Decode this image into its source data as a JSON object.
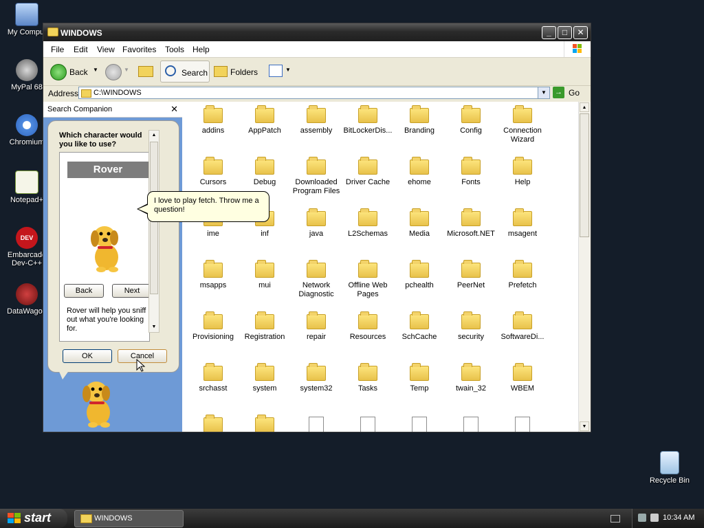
{
  "desktop": {
    "icons": [
      {
        "label": "My Comput",
        "icon": "computer-icon"
      },
      {
        "label": "MyPal 68",
        "icon": "raccoon-icon"
      },
      {
        "label": "Chromium",
        "icon": "chromium-icon"
      },
      {
        "label": "Notepad+",
        "icon": "notepad-icon"
      },
      {
        "label": "Embarcade\nDev-C++",
        "icon": "devcpp-icon"
      },
      {
        "label": "DataWagon",
        "icon": "datawagon-icon"
      }
    ],
    "recycle_bin": "Recycle Bin"
  },
  "window": {
    "title": "WINDOWS",
    "menu": [
      "File",
      "Edit",
      "View",
      "Favorites",
      "Tools",
      "Help"
    ],
    "toolbar": {
      "back": "Back",
      "search": "Search",
      "folders": "Folders"
    },
    "address": {
      "label": "Address",
      "value": "C:\\WINDOWS",
      "go": "Go"
    }
  },
  "companion": {
    "title": "Search Companion",
    "question": "Which character would you like to use?",
    "character_name": "Rover",
    "back": "Back",
    "next": "Next",
    "description": "Rover will help you sniff out what you're looking for.",
    "ok": "OK",
    "cancel": "Cancel",
    "speech": "I love to play fetch. Throw me a question!"
  },
  "files": [
    {
      "name": "addins",
      "type": "folder"
    },
    {
      "name": "AppPatch",
      "type": "folder"
    },
    {
      "name": "assembly",
      "type": "folder"
    },
    {
      "name": "BitLockerDis...",
      "type": "folder"
    },
    {
      "name": "Branding",
      "type": "folder"
    },
    {
      "name": "Config",
      "type": "folder"
    },
    {
      "name": "Connection Wizard",
      "type": "folder"
    },
    {
      "name": "Cursors",
      "type": "folder"
    },
    {
      "name": "Debug",
      "type": "folder"
    },
    {
      "name": "Downloaded Program Files",
      "type": "folder"
    },
    {
      "name": "Driver Cache",
      "type": "folder"
    },
    {
      "name": "ehome",
      "type": "folder"
    },
    {
      "name": "Fonts",
      "type": "folder"
    },
    {
      "name": "Help",
      "type": "folder"
    },
    {
      "name": "ime",
      "type": "folder"
    },
    {
      "name": "inf",
      "type": "folder"
    },
    {
      "name": "java",
      "type": "folder"
    },
    {
      "name": "L2Schemas",
      "type": "folder"
    },
    {
      "name": "Media",
      "type": "folder"
    },
    {
      "name": "Microsoft.NET",
      "type": "folder"
    },
    {
      "name": "msagent",
      "type": "folder"
    },
    {
      "name": "msapps",
      "type": "folder"
    },
    {
      "name": "mui",
      "type": "folder"
    },
    {
      "name": "Network Diagnostic",
      "type": "folder"
    },
    {
      "name": "Offline Web Pages",
      "type": "folder"
    },
    {
      "name": "pchealth",
      "type": "folder"
    },
    {
      "name": "PeerNet",
      "type": "folder"
    },
    {
      "name": "Prefetch",
      "type": "folder"
    },
    {
      "name": "Provisioning",
      "type": "folder"
    },
    {
      "name": "Registration",
      "type": "folder"
    },
    {
      "name": "repair",
      "type": "folder"
    },
    {
      "name": "Resources",
      "type": "folder"
    },
    {
      "name": "SchCache",
      "type": "folder"
    },
    {
      "name": "security",
      "type": "folder"
    },
    {
      "name": "SoftwareDi...",
      "type": "folder"
    },
    {
      "name": "srchasst",
      "type": "folder"
    },
    {
      "name": "system",
      "type": "folder"
    },
    {
      "name": "system32",
      "type": "folder"
    },
    {
      "name": "Tasks",
      "type": "folder"
    },
    {
      "name": "Temp",
      "type": "folder"
    },
    {
      "name": "twain_32",
      "type": "folder"
    },
    {
      "name": "WBEM",
      "type": "folder"
    },
    {
      "name": "",
      "type": "folder"
    },
    {
      "name": "",
      "type": "folder"
    },
    {
      "name": "",
      "type": "file"
    },
    {
      "name": "",
      "type": "file"
    },
    {
      "name": "",
      "type": "file"
    },
    {
      "name": "",
      "type": "file"
    },
    {
      "name": "",
      "type": "file"
    }
  ],
  "taskbar": {
    "start": "start",
    "window_button": "WINDOWS",
    "time": "10:34 AM"
  }
}
